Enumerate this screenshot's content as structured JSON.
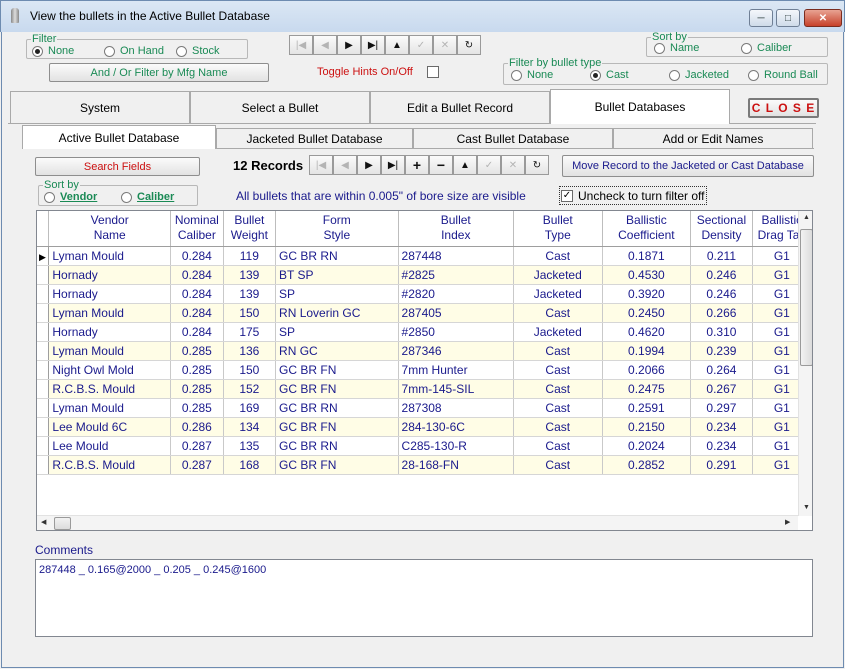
{
  "window": {
    "title": "View the bullets in the Active Bullet Database"
  },
  "filter": {
    "legend": "Filter",
    "options": [
      "None",
      "On Hand",
      "Stock"
    ],
    "selected": "None",
    "mfg_button": "And / Or Filter by Mfg Name"
  },
  "toggle_hints": "Toggle Hints On/Off",
  "sort_top": {
    "legend": "Sort by",
    "options": [
      "Name",
      "Caliber"
    ]
  },
  "bullet_type": {
    "legend": "Filter by bullet type",
    "options": [
      "None",
      "Cast",
      "Jacketed",
      "Round Ball"
    ],
    "selected": "Cast"
  },
  "main_tabs": [
    "System",
    "Select a Bullet",
    "Edit a Bullet Record",
    "Bullet Databases"
  ],
  "close_label": "C L O S E",
  "sub_tabs": [
    "Active Bullet Database",
    "Jacketed Bullet Database",
    "Cast Bullet Database",
    "Add or Edit Names"
  ],
  "search_button": "Search Fields",
  "record_count": "12 Records",
  "move_button": "Move Record to the Jacketed or Cast Database",
  "sort_lower": {
    "legend": "Sort by",
    "options": [
      "Vendor",
      "Caliber"
    ]
  },
  "filter_note": "All bullets that are within 0.005\" of bore size are visible",
  "filter_check": {
    "label": "Uncheck to turn filter off",
    "checked": true
  },
  "grid": {
    "headers": [
      [
        "Vendor",
        "Name"
      ],
      [
        "Nominal",
        "Caliber"
      ],
      [
        "Bullet",
        "Weight"
      ],
      [
        "Form",
        "Style"
      ],
      [
        "Bullet",
        "Index"
      ],
      [
        "Bullet",
        "Type"
      ],
      [
        "Ballistic",
        "Coefficient"
      ],
      [
        "Sectional",
        "Density"
      ],
      [
        "Ballistic",
        "Drag Tab"
      ]
    ],
    "rows": [
      [
        "Lyman Mould",
        "0.284",
        "119",
        "GC BR RN",
        "287448",
        "Cast",
        "0.1871",
        "0.211",
        "G1"
      ],
      [
        "Hornady",
        "0.284",
        "139",
        "BT SP",
        "#2825",
        "Jacketed",
        "0.4530",
        "0.246",
        "G1"
      ],
      [
        "Hornady",
        "0.284",
        "139",
        "SP",
        "#2820",
        "Jacketed",
        "0.3920",
        "0.246",
        "G1"
      ],
      [
        "Lyman Mould",
        "0.284",
        "150",
        "RN Loverin GC",
        "287405",
        "Cast",
        "0.2450",
        "0.266",
        "G1"
      ],
      [
        "Hornady",
        "0.284",
        "175",
        "SP",
        "#2850",
        "Jacketed",
        "0.4620",
        "0.310",
        "G1"
      ],
      [
        "Lyman Mould",
        "0.285",
        "136",
        "RN GC",
        "287346",
        "Cast",
        "0.1994",
        "0.239",
        "G1"
      ],
      [
        "Night Owl Mold",
        "0.285",
        "150",
        "GC BR FN",
        "7mm Hunter",
        "Cast",
        "0.2066",
        "0.264",
        "G1"
      ],
      [
        "R.C.B.S. Mould",
        "0.285",
        "152",
        "GC BR FN",
        "7mm-145-SIL",
        "Cast",
        "0.2475",
        "0.267",
        "G1"
      ],
      [
        "Lyman Mould",
        "0.285",
        "169",
        "GC BR RN",
        "287308",
        "Cast",
        "0.2591",
        "0.297",
        "G1"
      ],
      [
        "Lee Mould 6C",
        "0.286",
        "134",
        "GC BR FN",
        "284-130-6C",
        "Cast",
        "0.2150",
        "0.234",
        "G1"
      ],
      [
        "Lee Mould",
        "0.287",
        "135",
        "GC BR RN",
        "C285-130-R",
        "Cast",
        "0.2024",
        "0.234",
        "G1"
      ],
      [
        "R.C.B.S. Mould",
        "0.287",
        "168",
        "GC BR FN",
        "28-168-FN",
        "Cast",
        "0.2852",
        "0.291",
        "G1"
      ]
    ]
  },
  "comments": {
    "label": "Comments",
    "text": "287448 _ 0.165@2000 _ 0.205 _ 0.245@1600"
  },
  "colors": {
    "accent_green": "#1a8a55",
    "text_blue": "#1a1a8c",
    "close_red": "#cc1111",
    "alt_row": "#fffde6"
  }
}
